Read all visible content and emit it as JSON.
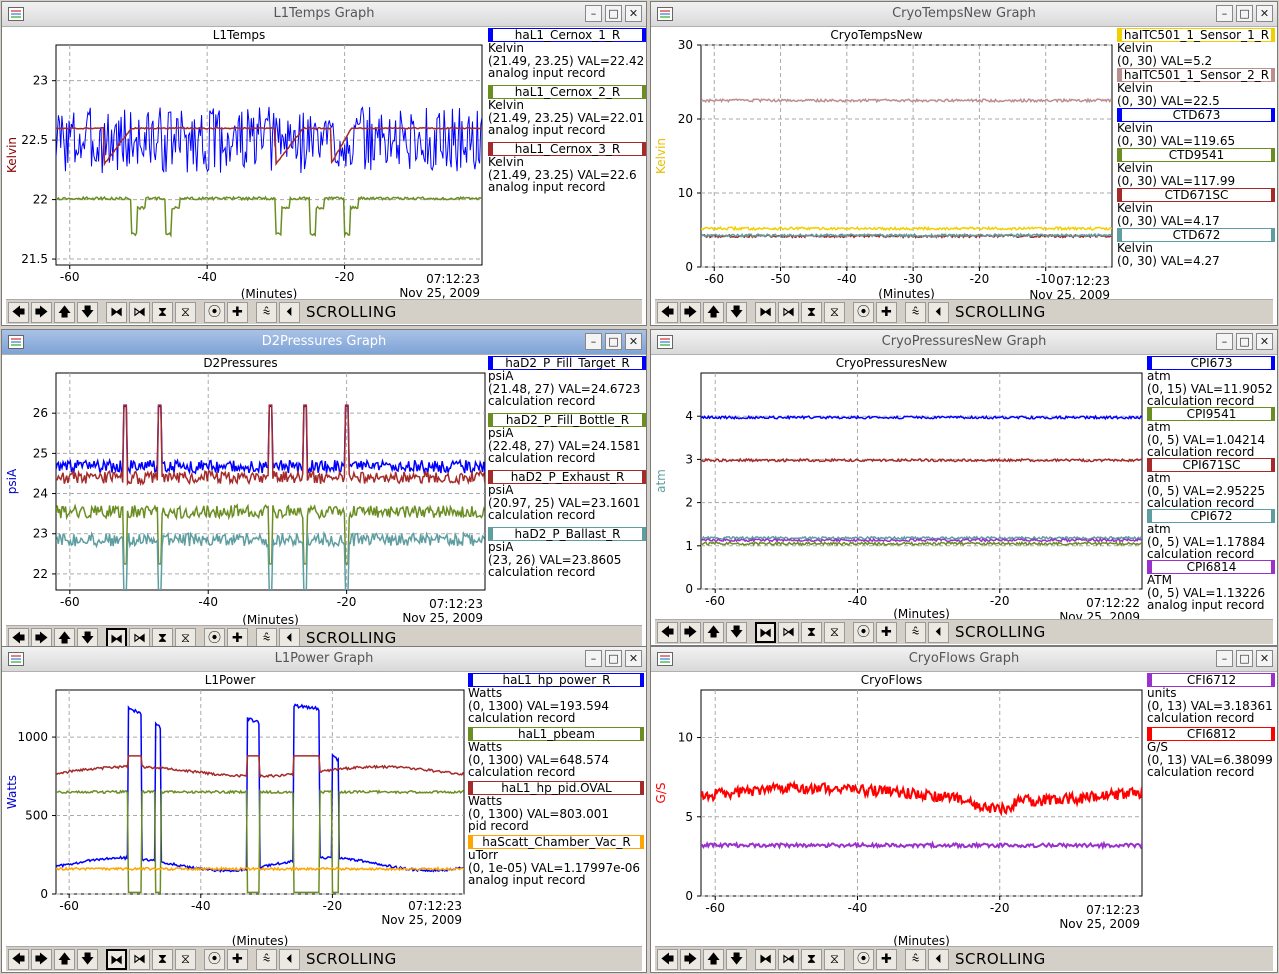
{
  "toolbar": {
    "buttons": [
      "pan-left",
      "pan-right",
      "pan-up",
      "pan-down",
      "zoom-in-x",
      "zoom-out-x",
      "zoom-in-y",
      "zoom-out-y",
      "autoscale",
      "add",
      "reset",
      "toggle"
    ],
    "glyphs": [
      "🡄",
      "🡆",
      "🡅",
      "🡇",
      "⧓",
      "⧒",
      "⧗",
      "⧖",
      "⦿",
      "✚",
      "⩯",
      "⏴"
    ],
    "mode": "SCROLLING"
  },
  "windows": [
    {
      "title": "L1Temps Graph",
      "chart_title": "L1Temps",
      "ylabel": "Kelvin",
      "ylabel_color": "#8b0000",
      "ylim": [
        21.45,
        23.3
      ],
      "yticks": [
        "23",
        "22.5",
        "22",
        "21.5"
      ],
      "xticks": [
        "-60",
        "-40",
        "-20"
      ],
      "time": "07:12:23",
      "date": "Nov 25, 2009",
      "xlabel": "(Minutes)",
      "legend": [
        {
          "name": "haL1_Cernox_1_R",
          "color": "#0000ff",
          "lines": [
            "Kelvin",
            "(21.49, 23.25) VAL=22.42",
            "analog input record"
          ]
        },
        {
          "name": "haL1_Cernox_2_R",
          "color": "#6b8e23",
          "lines": [
            "Kelvin",
            "(21.49, 23.25) VAL=22.01",
            "analog input record"
          ]
        },
        {
          "name": "haL1_Cernox_3_R",
          "color": "#a52a2a",
          "lines": [
            "Kelvin",
            "(21.49, 23.25) VAL=22.6",
            "analog input record"
          ]
        }
      ]
    },
    {
      "title": "CryoTempsNew Graph",
      "chart_title": "CryoTempsNew",
      "ylabel": "Kelvin",
      "ylabel_color": "#e6c000",
      "ylim": [
        0,
        30
      ],
      "yticks": [
        "30",
        "20",
        "10",
        "0"
      ],
      "xticks": [
        "-60",
        "-50",
        "-40",
        "-30",
        "-20",
        "-10"
      ],
      "time": "07:12:23",
      "date": "Nov 25, 2009",
      "xlabel": "(Minutes)",
      "legend": [
        {
          "name": "haITC501_1_Sensor_1_R",
          "color": "#f0d000",
          "lines": [
            "Kelvin",
            "(0, 30) VAL=5.2"
          ]
        },
        {
          "name": "haITC501_1_Sensor_2_R",
          "color": "#bc8f8f",
          "lines": [
            "Kelvin",
            "(0, 30) VAL=22.5"
          ]
        },
        {
          "name": "CTD673",
          "color": "#0000ff",
          "lines": [
            "Kelvin",
            "(0, 30) VAL=119.65"
          ]
        },
        {
          "name": "CTD9541",
          "color": "#6b8e23",
          "lines": [
            "Kelvin",
            "(0, 30) VAL=117.99"
          ]
        },
        {
          "name": "CTD671SC",
          "color": "#a52a2a",
          "lines": [
            "Kelvin",
            "(0, 30) VAL=4.17"
          ]
        },
        {
          "name": "CTD672",
          "color": "#5f9ea0",
          "lines": [
            "Kelvin",
            "(0, 30) VAL=4.27"
          ]
        }
      ]
    },
    {
      "title": "D2Pressures Graph",
      "chart_title": "D2Pressures",
      "ylabel": "psiA",
      "ylabel_color": "#0000cd",
      "ylim": [
        21.6,
        27.0
      ],
      "yticks": [
        "26",
        "25",
        "24",
        "23",
        "22"
      ],
      "xticks": [
        "-60",
        "-40",
        "-20"
      ],
      "time": "07:12:23",
      "date": "Nov 25, 2009",
      "xlabel": "(Minutes)",
      "legend": [
        {
          "name": "haD2_P_Fill_Target_R",
          "color": "#0000ff",
          "lines": [
            "psiA",
            "(21.48, 27) VAL=24.6723",
            "calculation record"
          ]
        },
        {
          "name": "haD2_P_Fill_Bottle_R",
          "color": "#6b8e23",
          "lines": [
            "psiA",
            "(22.48, 27) VAL=24.1581",
            "calculation record"
          ]
        },
        {
          "name": "haD2_P_Exhaust_R",
          "color": "#a52a2a",
          "lines": [
            "psiA",
            "(20.97, 25) VAL=23.1601",
            "calculation record"
          ]
        },
        {
          "name": "haD2_P_Ballast_R",
          "color": "#5f9ea0",
          "lines": [
            "psiA",
            "(23, 26) VAL=23.8605",
            "calculation record"
          ]
        }
      ]
    },
    {
      "title": "CryoPressuresNew Graph",
      "chart_title": "CryoPressuresNew",
      "ylabel": "atm",
      "ylabel_color": "#5f9ea0",
      "ylim": [
        0,
        5
      ],
      "yticks": [
        "4",
        "3",
        "2",
        "1",
        "0"
      ],
      "xticks": [
        "-60",
        "-40",
        "-20"
      ],
      "time": "07:12:22",
      "date": "Nov 25, 2009",
      "xlabel": "(Minutes)",
      "legend": [
        {
          "name": "CPI673",
          "color": "#0000ff",
          "lines": [
            "atm",
            "(0, 15) VAL=11.9052",
            "calculation record"
          ]
        },
        {
          "name": "CPI9541",
          "color": "#6b8e23",
          "lines": [
            "atm",
            "(0, 5) VAL=1.04214",
            "calculation record"
          ]
        },
        {
          "name": "CPI671SC",
          "color": "#a52a2a",
          "lines": [
            "atm",
            "(0, 5) VAL=2.95225",
            "calculation record"
          ]
        },
        {
          "name": "CPI672",
          "color": "#5f9ea0",
          "lines": [
            "atm",
            "(0, 5) VAL=1.17884",
            "calculation record"
          ]
        },
        {
          "name": "CPI6814",
          "color": "#9932cc",
          "lines": [
            "ATM",
            "(0, 5) VAL=1.13226",
            "analog input record"
          ]
        }
      ]
    },
    {
      "title": "L1Power Graph",
      "chart_title": "L1Power",
      "ylabel": "Watts",
      "ylabel_color": "#0000cd",
      "ylim": [
        0,
        1300
      ],
      "yticks": [
        "1000",
        "500",
        "0"
      ],
      "xticks": [
        "-60",
        "-40",
        "-20"
      ],
      "time": "07:12:23",
      "date": "Nov 25, 2009",
      "xlabel": "(Minutes)",
      "legend": [
        {
          "name": "haL1_hp_power_R",
          "color": "#0000ff",
          "lines": [
            "Watts",
            "(0, 1300) VAL=193.594",
            "calculation record"
          ]
        },
        {
          "name": "haL1_pbeam",
          "color": "#6b8e23",
          "lines": [
            "Watts",
            "(0, 1300) VAL=648.574",
            "calculation record"
          ]
        },
        {
          "name": "haL1_hp_pid.OVAL",
          "color": "#a52a2a",
          "lines": [
            "Watts",
            "(0, 1300) VAL=803.001",
            "pid record"
          ]
        },
        {
          "name": "haScatt_Chamber_Vac_R",
          "color": "#ffa500",
          "lines": [
            "uTorr",
            "(0, 1e-05) VAL=1.17997e-06",
            "analog input record"
          ]
        }
      ]
    },
    {
      "title": "CryoFlows Graph",
      "chart_title": "CryoFlows",
      "ylabel": "G/S",
      "ylabel_color": "#ff0000",
      "ylim": [
        0,
        13
      ],
      "yticks": [
        "10",
        "5",
        "0"
      ],
      "xticks": [
        "-60",
        "-40",
        "-20"
      ],
      "time": "07:12:23",
      "date": "Nov 25, 2009",
      "xlabel": "(Minutes)",
      "legend": [
        {
          "name": "CFI6712",
          "color": "#9932cc",
          "lines": [
            "units",
            "(0, 13) VAL=3.18361",
            "calculation record"
          ]
        },
        {
          "name": "CFI6812",
          "color": "#ff0000",
          "lines": [
            "G/S",
            "(0, 13) VAL=6.38099",
            "calculation record"
          ]
        }
      ]
    }
  ],
  "chart_data": [
    {
      "type": "line",
      "title": "L1Temps",
      "xlabel": "(Minutes)",
      "ylabel": "Kelvin",
      "xlim": [
        -62,
        0
      ],
      "ylim": [
        21.45,
        23.3
      ],
      "series": [
        {
          "name": "haL1_Cernox_1_R",
          "base": 22.5,
          "noise": 0.28
        },
        {
          "name": "haL1_Cernox_2_R",
          "base": 22.01,
          "dips": [
            -51,
            -46,
            -30,
            -25,
            -20
          ],
          "dip": -0.2
        },
        {
          "name": "haL1_Cernox_3_R",
          "base": 22.6,
          "level": 22.6,
          "drops": [
            [
              -55,
              -51
            ],
            [
              -30,
              -26
            ],
            [
              -22,
              -19
            ]
          ],
          "low": 22.3
        }
      ]
    },
    {
      "type": "line",
      "title": "CryoTempsNew",
      "xlabel": "(Minutes)",
      "ylabel": "Kelvin",
      "xlim": [
        -62,
        0
      ],
      "ylim": [
        0,
        30
      ],
      "series": [
        {
          "name": "haITC501_1_Sensor_2_R",
          "base": 22.5
        },
        {
          "name": "haITC501_1_Sensor_1_R",
          "base": 5.2
        },
        {
          "name": "CTD671SC",
          "base": 4.17
        },
        {
          "name": "CTD672",
          "base": 4.27
        }
      ]
    },
    {
      "type": "line",
      "title": "D2Pressures",
      "xlabel": "(Minutes)",
      "ylabel": "psiA",
      "xlim": [
        -62,
        0
      ],
      "ylim": [
        21.6,
        27.0
      ],
      "series": [
        {
          "name": "haD2_P_Fill_Target_R",
          "base": 24.67
        },
        {
          "name": "haD2_P_Exhaust_R",
          "base": 24.4
        },
        {
          "name": "haD2_P_Fill_Bottle_R",
          "base": 23.55
        },
        {
          "name": "haD2_P_Ballast_R",
          "base": 22.85
        }
      ],
      "spikes": [
        -52,
        -47,
        -31,
        -26,
        -20
      ]
    },
    {
      "type": "line",
      "title": "CryoPressuresNew",
      "xlabel": "(Minutes)",
      "ylabel": "atm",
      "xlim": [
        -62,
        0
      ],
      "ylim": [
        0,
        5
      ],
      "series": [
        {
          "name": "CPI673",
          "base": 3.97
        },
        {
          "name": "CPI671SC",
          "base": 2.98
        },
        {
          "name": "CPI672",
          "base": 1.18
        },
        {
          "name": "CPI6814",
          "base": 1.13
        },
        {
          "name": "CPI9541",
          "base": 1.05
        }
      ]
    },
    {
      "type": "line",
      "title": "L1Power",
      "xlabel": "(Minutes)",
      "ylabel": "Watts",
      "xlim": [
        -62,
        0
      ],
      "ylim": [
        0,
        1300
      ],
      "series": [
        {
          "name": "haL1_hp_power_R",
          "base": 190,
          "peaks": [
            [
              -51,
              -49,
              1150
            ],
            [
              -47,
              -46,
              1080
            ],
            [
              -33,
              -31,
              1150
            ],
            [
              -26,
              -22,
              1180
            ],
            [
              -20,
              -19,
              850
            ]
          ]
        },
        {
          "name": "haL1_pbeam",
          "base": 650
        },
        {
          "name": "haL1_hp_pid.OVAL",
          "base": 780
        },
        {
          "name": "haScatt_Chamber_Vac_R",
          "base": 160
        }
      ]
    },
    {
      "type": "line",
      "title": "CryoFlows",
      "xlabel": "(Minutes)",
      "ylabel": "G/S",
      "xlim": [
        -62,
        0
      ],
      "ylim": [
        0,
        13
      ],
      "series": [
        {
          "name": "CFI6812",
          "base": 6.4
        },
        {
          "name": "CFI6712",
          "base": 3.2
        }
      ]
    }
  ]
}
